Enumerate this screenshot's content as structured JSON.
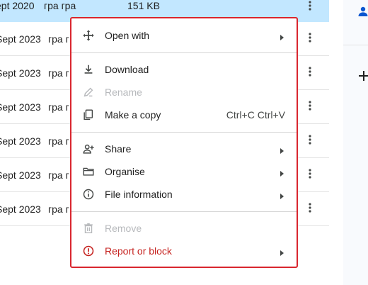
{
  "file_rows": [
    {
      "date": "ept 2020",
      "owner": "гра гра",
      "size": "151 KB"
    },
    {
      "date": "Sept 2023",
      "owner": "гра г",
      "size": ""
    },
    {
      "date": "Sept 2023",
      "owner": "гра г",
      "size": ""
    },
    {
      "date": "Sept 2023",
      "owner": "гра г",
      "size": ""
    },
    {
      "date": "Sept 2023",
      "owner": "гра г",
      "size": ""
    },
    {
      "date": "Sept 2023",
      "owner": "гра г",
      "size": ""
    },
    {
      "date": "Sept 2023",
      "owner": "гра г",
      "size": ""
    }
  ],
  "context_menu": {
    "open_with": {
      "label": "Open with",
      "icon": "open-with-icon"
    },
    "download": {
      "label": "Download",
      "icon": "download-icon"
    },
    "rename": {
      "label": "Rename",
      "icon": "edit-icon",
      "disabled": true
    },
    "make_copy": {
      "label": "Make a copy",
      "shortcut": "Ctrl+C Ctrl+V",
      "icon": "copy-icon"
    },
    "share": {
      "label": "Share",
      "icon": "person-add-icon"
    },
    "organise": {
      "label": "Organise",
      "icon": "folder-icon"
    },
    "file_information": {
      "label": "File information",
      "icon": "info-icon"
    },
    "remove": {
      "label": "Remove",
      "icon": "trash-icon",
      "disabled": true
    },
    "report": {
      "label": "Report or block",
      "icon": "report-icon"
    }
  },
  "colors": {
    "selected_row": "#c2e7ff",
    "menu_outline": "#d9262f",
    "danger_text": "#c5221f",
    "disabled_text": "#b7b9bc",
    "side_panel": "#f8fafd"
  }
}
